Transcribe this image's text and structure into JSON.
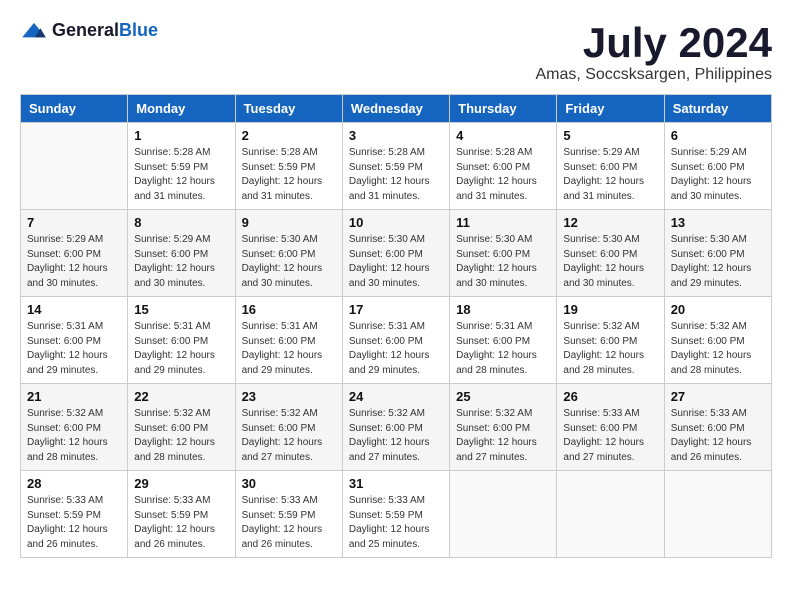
{
  "header": {
    "logo_general": "General",
    "logo_blue": "Blue",
    "month_year": "July 2024",
    "location": "Amas, Soccsksargen, Philippines"
  },
  "days_of_week": [
    "Sunday",
    "Monday",
    "Tuesday",
    "Wednesday",
    "Thursday",
    "Friday",
    "Saturday"
  ],
  "weeks": [
    [
      {
        "day": "",
        "sunrise": "",
        "sunset": "",
        "daylight": ""
      },
      {
        "day": "1",
        "sunrise": "Sunrise: 5:28 AM",
        "sunset": "Sunset: 5:59 PM",
        "daylight": "Daylight: 12 hours and 31 minutes."
      },
      {
        "day": "2",
        "sunrise": "Sunrise: 5:28 AM",
        "sunset": "Sunset: 5:59 PM",
        "daylight": "Daylight: 12 hours and 31 minutes."
      },
      {
        "day": "3",
        "sunrise": "Sunrise: 5:28 AM",
        "sunset": "Sunset: 5:59 PM",
        "daylight": "Daylight: 12 hours and 31 minutes."
      },
      {
        "day": "4",
        "sunrise": "Sunrise: 5:28 AM",
        "sunset": "Sunset: 6:00 PM",
        "daylight": "Daylight: 12 hours and 31 minutes."
      },
      {
        "day": "5",
        "sunrise": "Sunrise: 5:29 AM",
        "sunset": "Sunset: 6:00 PM",
        "daylight": "Daylight: 12 hours and 31 minutes."
      },
      {
        "day": "6",
        "sunrise": "Sunrise: 5:29 AM",
        "sunset": "Sunset: 6:00 PM",
        "daylight": "Daylight: 12 hours and 30 minutes."
      }
    ],
    [
      {
        "day": "7",
        "sunrise": "Sunrise: 5:29 AM",
        "sunset": "Sunset: 6:00 PM",
        "daylight": "Daylight: 12 hours and 30 minutes."
      },
      {
        "day": "8",
        "sunrise": "Sunrise: 5:29 AM",
        "sunset": "Sunset: 6:00 PM",
        "daylight": "Daylight: 12 hours and 30 minutes."
      },
      {
        "day": "9",
        "sunrise": "Sunrise: 5:30 AM",
        "sunset": "Sunset: 6:00 PM",
        "daylight": "Daylight: 12 hours and 30 minutes."
      },
      {
        "day": "10",
        "sunrise": "Sunrise: 5:30 AM",
        "sunset": "Sunset: 6:00 PM",
        "daylight": "Daylight: 12 hours and 30 minutes."
      },
      {
        "day": "11",
        "sunrise": "Sunrise: 5:30 AM",
        "sunset": "Sunset: 6:00 PM",
        "daylight": "Daylight: 12 hours and 30 minutes."
      },
      {
        "day": "12",
        "sunrise": "Sunrise: 5:30 AM",
        "sunset": "Sunset: 6:00 PM",
        "daylight": "Daylight: 12 hours and 30 minutes."
      },
      {
        "day": "13",
        "sunrise": "Sunrise: 5:30 AM",
        "sunset": "Sunset: 6:00 PM",
        "daylight": "Daylight: 12 hours and 29 minutes."
      }
    ],
    [
      {
        "day": "14",
        "sunrise": "Sunrise: 5:31 AM",
        "sunset": "Sunset: 6:00 PM",
        "daylight": "Daylight: 12 hours and 29 minutes."
      },
      {
        "day": "15",
        "sunrise": "Sunrise: 5:31 AM",
        "sunset": "Sunset: 6:00 PM",
        "daylight": "Daylight: 12 hours and 29 minutes."
      },
      {
        "day": "16",
        "sunrise": "Sunrise: 5:31 AM",
        "sunset": "Sunset: 6:00 PM",
        "daylight": "Daylight: 12 hours and 29 minutes."
      },
      {
        "day": "17",
        "sunrise": "Sunrise: 5:31 AM",
        "sunset": "Sunset: 6:00 PM",
        "daylight": "Daylight: 12 hours and 29 minutes."
      },
      {
        "day": "18",
        "sunrise": "Sunrise: 5:31 AM",
        "sunset": "Sunset: 6:00 PM",
        "daylight": "Daylight: 12 hours and 28 minutes."
      },
      {
        "day": "19",
        "sunrise": "Sunrise: 5:32 AM",
        "sunset": "Sunset: 6:00 PM",
        "daylight": "Daylight: 12 hours and 28 minutes."
      },
      {
        "day": "20",
        "sunrise": "Sunrise: 5:32 AM",
        "sunset": "Sunset: 6:00 PM",
        "daylight": "Daylight: 12 hours and 28 minutes."
      }
    ],
    [
      {
        "day": "21",
        "sunrise": "Sunrise: 5:32 AM",
        "sunset": "Sunset: 6:00 PM",
        "daylight": "Daylight: 12 hours and 28 minutes."
      },
      {
        "day": "22",
        "sunrise": "Sunrise: 5:32 AM",
        "sunset": "Sunset: 6:00 PM",
        "daylight": "Daylight: 12 hours and 28 minutes."
      },
      {
        "day": "23",
        "sunrise": "Sunrise: 5:32 AM",
        "sunset": "Sunset: 6:00 PM",
        "daylight": "Daylight: 12 hours and 27 minutes."
      },
      {
        "day": "24",
        "sunrise": "Sunrise: 5:32 AM",
        "sunset": "Sunset: 6:00 PM",
        "daylight": "Daylight: 12 hours and 27 minutes."
      },
      {
        "day": "25",
        "sunrise": "Sunrise: 5:32 AM",
        "sunset": "Sunset: 6:00 PM",
        "daylight": "Daylight: 12 hours and 27 minutes."
      },
      {
        "day": "26",
        "sunrise": "Sunrise: 5:33 AM",
        "sunset": "Sunset: 6:00 PM",
        "daylight": "Daylight: 12 hours and 27 minutes."
      },
      {
        "day": "27",
        "sunrise": "Sunrise: 5:33 AM",
        "sunset": "Sunset: 6:00 PM",
        "daylight": "Daylight: 12 hours and 26 minutes."
      }
    ],
    [
      {
        "day": "28",
        "sunrise": "Sunrise: 5:33 AM",
        "sunset": "Sunset: 5:59 PM",
        "daylight": "Daylight: 12 hours and 26 minutes."
      },
      {
        "day": "29",
        "sunrise": "Sunrise: 5:33 AM",
        "sunset": "Sunset: 5:59 PM",
        "daylight": "Daylight: 12 hours and 26 minutes."
      },
      {
        "day": "30",
        "sunrise": "Sunrise: 5:33 AM",
        "sunset": "Sunset: 5:59 PM",
        "daylight": "Daylight: 12 hours and 26 minutes."
      },
      {
        "day": "31",
        "sunrise": "Sunrise: 5:33 AM",
        "sunset": "Sunset: 5:59 PM",
        "daylight": "Daylight: 12 hours and 25 minutes."
      },
      {
        "day": "",
        "sunrise": "",
        "sunset": "",
        "daylight": ""
      },
      {
        "day": "",
        "sunrise": "",
        "sunset": "",
        "daylight": ""
      },
      {
        "day": "",
        "sunrise": "",
        "sunset": "",
        "daylight": ""
      }
    ]
  ]
}
